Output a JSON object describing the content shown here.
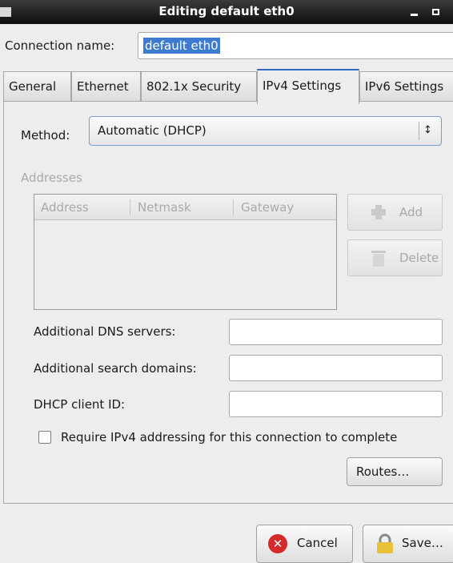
{
  "window": {
    "title": "Editing default eth0"
  },
  "connection": {
    "label": "Connection name:",
    "value": "default eth0"
  },
  "tabs": [
    {
      "label": "General"
    },
    {
      "label": "Ethernet"
    },
    {
      "label": "802.1x Security"
    },
    {
      "label": "IPv4 Settings",
      "active": true
    },
    {
      "label": "IPv6 Settings"
    }
  ],
  "method": {
    "label": "Method:",
    "value": "Automatic (DHCP)"
  },
  "addresses": {
    "title": "Addresses",
    "columns": [
      "Address",
      "Netmask",
      "Gateway"
    ],
    "add_label": "Add",
    "delete_label": "Delete"
  },
  "fields": {
    "dns_label": "Additional DNS servers:",
    "search_label": "Additional search domains:",
    "dhcp_label": "DHCP client ID:"
  },
  "require": {
    "label": "Require IPv4 addressing for this connection to complete",
    "checked": false
  },
  "routes_label": "Routes…",
  "buttons": {
    "cancel_label": "Cancel",
    "save_label": "Save…"
  },
  "colors": {
    "accent": "#3d7bd1",
    "titlebar": "#1a1a1a",
    "cancel_icon": "#d42a2a"
  }
}
